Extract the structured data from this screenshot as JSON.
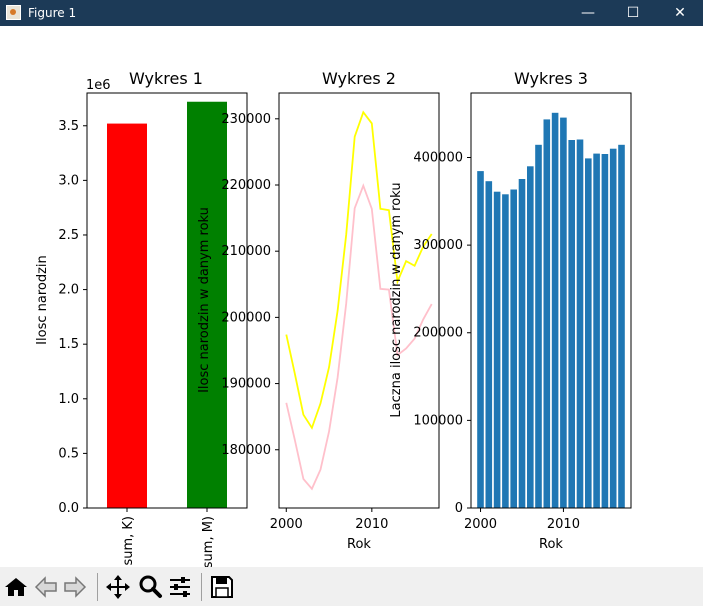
{
  "window": {
    "title": "Figure 1",
    "minimize_glyph": "—",
    "maximize_glyph": "☐",
    "close_glyph": "✕"
  },
  "toolbar": {
    "buttons": [
      {
        "name": "home-button",
        "icon": "home-icon"
      },
      {
        "name": "back-button",
        "icon": "arrow-left-icon"
      },
      {
        "name": "forward-button",
        "icon": "arrow-right-icon"
      },
      {
        "name": "pan-button",
        "icon": "move-icon"
      },
      {
        "name": "zoom-button",
        "icon": "magnifier-icon"
      },
      {
        "name": "configure-subplots-button",
        "icon": "sliders-icon"
      },
      {
        "name": "save-button",
        "icon": "floppy-disk-icon"
      }
    ]
  },
  "chart_data": [
    {
      "type": "bar",
      "title": "Wykres 1",
      "xlabel": "",
      "ylabel": "Ilosc narodzin",
      "offset_label": "1e6",
      "categories": [
        "(sum, K)",
        "(sum, M)"
      ],
      "category_labels_visible": [
        "sum, K)",
        "sum, M)"
      ],
      "values": [
        3.52,
        3.72
      ],
      "colors": [
        "#ff0000",
        "#008000"
      ],
      "ylim": [
        0,
        3.8
      ],
      "yticks": [
        0.0,
        0.5,
        1.0,
        1.5,
        2.0,
        2.5,
        3.0,
        3.5
      ],
      "ytick_labels": [
        "0.0",
        "0.5",
        "1.0",
        "1.5",
        "2.0",
        "2.5",
        "3.0",
        "3.5"
      ]
    },
    {
      "type": "line",
      "title": "Wykres 2",
      "xlabel": "Rok",
      "ylabel": "Ilosc narodzin w danym roku",
      "x": [
        2000,
        2001,
        2002,
        2003,
        2004,
        2005,
        2006,
        2007,
        2008,
        2009,
        2010,
        2011,
        2012,
        2013,
        2014,
        2015,
        2016,
        2017
      ],
      "series": [
        {
          "color": "#ffff00",
          "values": [
            197400,
            191500,
            185300,
            183300,
            187000,
            192500,
            201000,
            212500,
            227300,
            231000,
            229300,
            216400,
            216200,
            205400,
            208500,
            207800,
            210700,
            212600
          ]
        },
        {
          "color": "#ffc0cb",
          "values": [
            187100,
            181500,
            175600,
            174100,
            177000,
            182800,
            190900,
            202100,
            216500,
            219900,
            216400,
            204300,
            204200,
            194300,
            195300,
            196800,
            199700,
            202000
          ]
        }
      ],
      "xlim": [
        1999.15,
        2017.85
      ],
      "ylim": [
        171200,
        233900
      ],
      "xticks": [
        2000,
        2010
      ],
      "xtick_labels": [
        "2000",
        "2010"
      ],
      "yticks": [
        180000,
        190000,
        200000,
        210000,
        220000,
        230000
      ],
      "ytick_labels": [
        "180000",
        "190000",
        "200000",
        "210000",
        "220000",
        "230000"
      ]
    },
    {
      "type": "bar",
      "title": "Wykres 3",
      "xlabel": "Rok",
      "ylabel": "Laczna ilosc narodzin w danym roku",
      "x": [
        2000,
        2001,
        2002,
        2003,
        2004,
        2005,
        2006,
        2007,
        2008,
        2009,
        2010,
        2011,
        2012,
        2013,
        2014,
        2015,
        2016,
        2017
      ],
      "values": [
        384500,
        373000,
        361000,
        358000,
        363500,
        375500,
        390000,
        414500,
        443500,
        451000,
        445500,
        420000,
        420500,
        399000,
        404500,
        404000,
        410000,
        414500
      ],
      "color": "#1f77b4",
      "xlim": [
        1998.85,
        2018.15
      ],
      "ylim": [
        0,
        473600
      ],
      "xticks": [
        2000,
        2010
      ],
      "xtick_labels": [
        "2000",
        "2010"
      ],
      "yticks": [
        0,
        100000,
        200000,
        300000,
        400000
      ],
      "ytick_labels": [
        "0",
        "100000",
        "200000",
        "300000",
        "400000"
      ]
    }
  ]
}
